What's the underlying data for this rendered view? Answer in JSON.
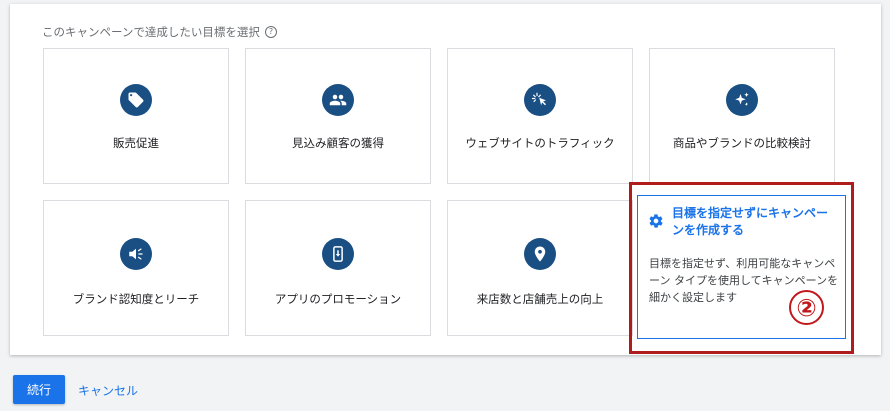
{
  "heading": {
    "text": "このキャンペーンで達成したい目標を選択",
    "help_icon": "?"
  },
  "goals": [
    {
      "label": "販売促進",
      "icon": "tag-icon"
    },
    {
      "label": "見込み顧客の獲得",
      "icon": "people-icon"
    },
    {
      "label": "ウェブサイトのトラフィック",
      "icon": "cursor-click-icon"
    },
    {
      "label": "商品やブランドの比較検討",
      "icon": "sparkle-icon"
    },
    {
      "label": "ブランド認知度とリーチ",
      "icon": "megaphone-icon"
    },
    {
      "label": "アプリのプロモーション",
      "icon": "phone-icon"
    },
    {
      "label": "来店数と店舗売上の向上",
      "icon": "location-pin-icon"
    }
  ],
  "no_goal": {
    "title": "目標を指定せずにキャンペーンを作成する",
    "description": "目標を指定せず、利用可能なキャンペーン タイプを使用してキャンペーンを細かく設定します",
    "icon": "gear-icon",
    "marker": "②"
  },
  "footer": {
    "continue_label": "続行",
    "cancel_label": "キャンセル"
  },
  "colors": {
    "accent": "#1a73e8",
    "icon_circle": "#1a4f83",
    "highlight": "#b01c1c"
  }
}
